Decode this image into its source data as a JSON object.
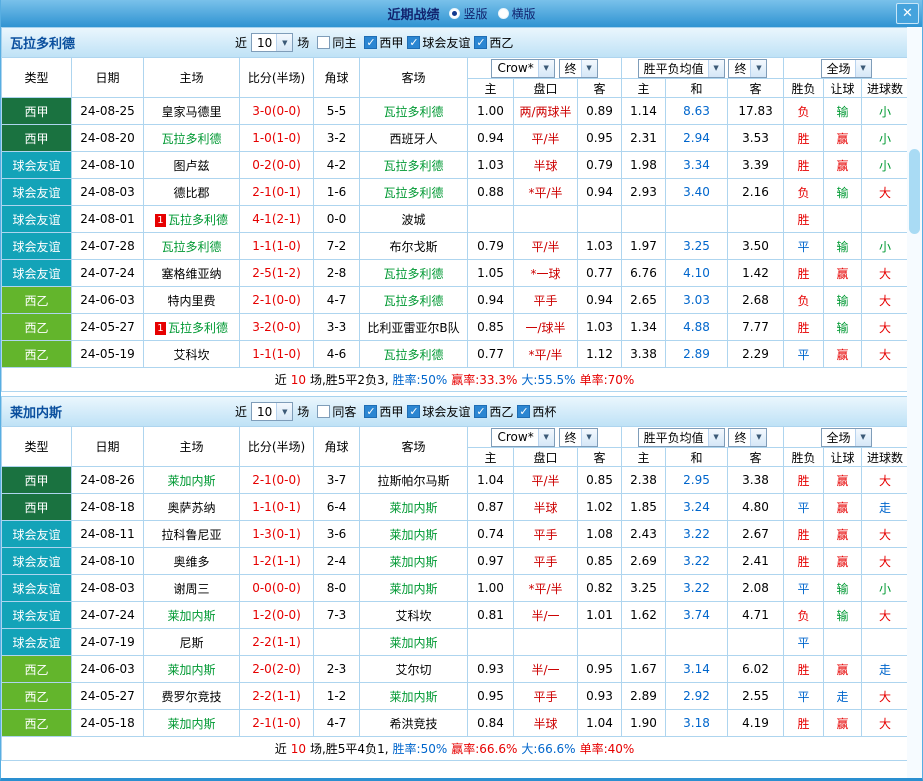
{
  "colors": {
    "titlebar_blue": "#2f93d2",
    "section_header_blue": "#bfe2f6",
    "table_border": "#aed5ef",
    "liga_badge_green": "#1a7240",
    "friendly_badge_teal": "#13a3b8",
    "segunda_badge_green": "#63b52c",
    "score_red": "#e60000",
    "self_team_green": "#009933",
    "draw_blue": "#0066cc"
  },
  "titlebar": {
    "title": "近期战绩",
    "radios": [
      {
        "label": "竖版",
        "selected": true
      },
      {
        "label": "横版",
        "selected": false
      }
    ],
    "close": "✕"
  },
  "sections": [
    {
      "team": "瓦拉多利德",
      "filters": {
        "near_label": "近",
        "count": "10",
        "games_label": "场",
        "same": {
          "label": "同主",
          "checked": false
        },
        "leagues": [
          {
            "label": "西甲",
            "checked": true
          },
          {
            "label": "球会友谊",
            "checked": true
          },
          {
            "label": "西乙",
            "checked": true
          }
        ]
      },
      "header": {
        "col_type": "类型",
        "col_date": "日期",
        "col_home": "主场",
        "col_score": "比分(半场)",
        "col_corner": "角球",
        "col_away": "客场",
        "odds_select": "Crow*",
        "odds_final": "终",
        "avg_select": "胜平负均值",
        "avg_final": "终",
        "scope_select": "全场",
        "sub": [
          "主",
          "盘口",
          "客",
          "主",
          "和",
          "客",
          "胜负",
          "让球",
          "进球数"
        ]
      },
      "rows": [
        {
          "type": "西甲",
          "tc": "lg1",
          "date": "24-08-25",
          "home": "皇家马德里",
          "hs": false,
          "hb": "",
          "score": "3-0(0-0)",
          "corner": "5-5",
          "away": "瓦拉多利德",
          "as": true,
          "o": [
            "1.00",
            "两/两球半",
            "0.89"
          ],
          "a": [
            "1.14",
            "8.63",
            "17.83"
          ],
          "r": [
            [
              "负",
              "red"
            ],
            [
              "输",
              "green"
            ],
            [
              "小",
              "green"
            ]
          ]
        },
        {
          "type": "西甲",
          "tc": "lg1",
          "date": "24-08-20",
          "home": "瓦拉多利德",
          "hs": true,
          "hb": "",
          "score": "1-0(1-0)",
          "corner": "3-2",
          "away": "西班牙人",
          "as": false,
          "o": [
            "0.94",
            "平/半",
            "0.95"
          ],
          "a": [
            "2.31",
            "2.94",
            "3.53"
          ],
          "r": [
            [
              "胜",
              "red"
            ],
            [
              "赢",
              "red"
            ],
            [
              "小",
              "green"
            ]
          ]
        },
        {
          "type": "球会友谊",
          "tc": "lg2",
          "date": "24-08-10",
          "home": "图卢兹",
          "hs": false,
          "hb": "",
          "score": "0-2(0-0)",
          "corner": "4-2",
          "away": "瓦拉多利德",
          "as": true,
          "o": [
            "1.03",
            "半球",
            "0.79"
          ],
          "a": [
            "1.98",
            "3.34",
            "3.39"
          ],
          "r": [
            [
              "胜",
              "red"
            ],
            [
              "赢",
              "red"
            ],
            [
              "小",
              "green"
            ]
          ]
        },
        {
          "type": "球会友谊",
          "tc": "lg2",
          "date": "24-08-03",
          "home": "德比郡",
          "hs": false,
          "hb": "",
          "score": "2-1(0-1)",
          "corner": "1-6",
          "away": "瓦拉多利德",
          "as": true,
          "o": [
            "0.88",
            "*平/半",
            "0.94"
          ],
          "a": [
            "2.93",
            "3.40",
            "2.16"
          ],
          "r": [
            [
              "负",
              "red"
            ],
            [
              "输",
              "green"
            ],
            [
              "大",
              "red"
            ]
          ]
        },
        {
          "type": "球会友谊",
          "tc": "lg2",
          "date": "24-08-01",
          "home": "瓦拉多利德",
          "hs": true,
          "hb": "1",
          "score": "4-1(2-1)",
          "corner": "0-0",
          "away": "波城",
          "as": false,
          "o": [
            "",
            "",
            ""
          ],
          "a": [
            "",
            "",
            ""
          ],
          "r": [
            [
              "胜",
              "red"
            ],
            [
              "",
              ""
            ],
            [
              "",
              ""
            ]
          ]
        },
        {
          "type": "球会友谊",
          "tc": "lg2",
          "date": "24-07-28",
          "home": "瓦拉多利德",
          "hs": true,
          "hb": "",
          "score": "1-1(1-0)",
          "corner": "7-2",
          "away": "布尔戈斯",
          "as": false,
          "o": [
            "0.79",
            "平/半",
            "1.03"
          ],
          "a": [
            "1.97",
            "3.25",
            "3.50"
          ],
          "r": [
            [
              "平",
              "blue"
            ],
            [
              "输",
              "green"
            ],
            [
              "小",
              "green"
            ]
          ]
        },
        {
          "type": "球会友谊",
          "tc": "lg2",
          "date": "24-07-24",
          "home": "塞格维亚纳",
          "hs": false,
          "hb": "",
          "score": "2-5(1-2)",
          "corner": "2-8",
          "away": "瓦拉多利德",
          "as": true,
          "o": [
            "1.05",
            "*一球",
            "0.77"
          ],
          "a": [
            "6.76",
            "4.10",
            "1.42"
          ],
          "r": [
            [
              "胜",
              "red"
            ],
            [
              "赢",
              "red"
            ],
            [
              "大",
              "red"
            ]
          ]
        },
        {
          "type": "西乙",
          "tc": "lg3",
          "date": "24-06-03",
          "home": "特内里费",
          "hs": false,
          "hb": "",
          "score": "2-1(0-0)",
          "corner": "4-7",
          "away": "瓦拉多利德",
          "as": true,
          "o": [
            "0.94",
            "平手",
            "0.94"
          ],
          "a": [
            "2.65",
            "3.03",
            "2.68"
          ],
          "r": [
            [
              "负",
              "red"
            ],
            [
              "输",
              "green"
            ],
            [
              "大",
              "red"
            ]
          ]
        },
        {
          "type": "西乙",
          "tc": "lg3",
          "date": "24-05-27",
          "home": "瓦拉多利德",
          "hs": true,
          "hb": "1",
          "score": "3-2(0-0)",
          "corner": "3-3",
          "away": "比利亚雷亚尔B队",
          "as": false,
          "o": [
            "0.85",
            "一/球半",
            "1.03"
          ],
          "a": [
            "1.34",
            "4.88",
            "7.77"
          ],
          "r": [
            [
              "胜",
              "red"
            ],
            [
              "输",
              "green"
            ],
            [
              "大",
              "red"
            ]
          ]
        },
        {
          "type": "西乙",
          "tc": "lg3",
          "date": "24-05-19",
          "home": "艾科坎",
          "hs": false,
          "hb": "",
          "score": "1-1(1-0)",
          "corner": "4-6",
          "away": "瓦拉多利德",
          "as": true,
          "o": [
            "0.77",
            "*平/半",
            "1.12"
          ],
          "a": [
            "3.38",
            "2.89",
            "2.29"
          ],
          "r": [
            [
              "平",
              "blue"
            ],
            [
              "赢",
              "red"
            ],
            [
              "大",
              "red"
            ]
          ]
        }
      ],
      "summary": [
        {
          "t": "近",
          "c": "dark"
        },
        {
          "t": "10",
          "c": "red"
        },
        {
          "t": "场,胜5平2负3,",
          "c": "dark"
        },
        {
          "t": "胜率:50%",
          "c": "blue"
        },
        {
          "t": "赢率:33.3%",
          "c": "red"
        },
        {
          "t": "大:55.5%",
          "c": "blue"
        },
        {
          "t": "单率:70%",
          "c": "red"
        }
      ]
    },
    {
      "team": "莱加内斯",
      "filters": {
        "near_label": "近",
        "count": "10",
        "games_label": "场",
        "same": {
          "label": "同客",
          "checked": false
        },
        "leagues": [
          {
            "label": "西甲",
            "checked": true
          },
          {
            "label": "球会友谊",
            "checked": true
          },
          {
            "label": "西乙",
            "checked": true
          },
          {
            "label": "西杯",
            "checked": true
          }
        ]
      },
      "header": {
        "col_type": "类型",
        "col_date": "日期",
        "col_home": "主场",
        "col_score": "比分(半场)",
        "col_corner": "角球",
        "col_away": "客场",
        "odds_select": "Crow*",
        "odds_final": "终",
        "avg_select": "胜平负均值",
        "avg_final": "终",
        "scope_select": "全场",
        "sub": [
          "主",
          "盘口",
          "客",
          "主",
          "和",
          "客",
          "胜负",
          "让球",
          "进球数"
        ]
      },
      "rows": [
        {
          "type": "西甲",
          "tc": "lg1",
          "date": "24-08-26",
          "home": "莱加内斯",
          "hs": true,
          "hb": "",
          "score": "2-1(0-0)",
          "corner": "3-7",
          "away": "拉斯帕尔马斯",
          "as": false,
          "o": [
            "1.04",
            "平/半",
            "0.85"
          ],
          "a": [
            "2.38",
            "2.95",
            "3.38"
          ],
          "r": [
            [
              "胜",
              "red"
            ],
            [
              "赢",
              "red"
            ],
            [
              "大",
              "red"
            ]
          ]
        },
        {
          "type": "西甲",
          "tc": "lg1",
          "date": "24-08-18",
          "home": "奥萨苏纳",
          "hs": false,
          "hb": "",
          "score": "1-1(0-1)",
          "corner": "6-4",
          "away": "莱加内斯",
          "as": true,
          "o": [
            "0.87",
            "半球",
            "1.02"
          ],
          "a": [
            "1.85",
            "3.24",
            "4.80"
          ],
          "r": [
            [
              "平",
              "blue"
            ],
            [
              "赢",
              "red"
            ],
            [
              "走",
              "blue"
            ]
          ]
        },
        {
          "type": "球会友谊",
          "tc": "lg2",
          "date": "24-08-11",
          "home": "拉科鲁尼亚",
          "hs": false,
          "hb": "",
          "score": "1-3(0-1)",
          "corner": "3-6",
          "away": "莱加内斯",
          "as": true,
          "o": [
            "0.74",
            "平手",
            "1.08"
          ],
          "a": [
            "2.43",
            "3.22",
            "2.67"
          ],
          "r": [
            [
              "胜",
              "red"
            ],
            [
              "赢",
              "red"
            ],
            [
              "大",
              "red"
            ]
          ]
        },
        {
          "type": "球会友谊",
          "tc": "lg2",
          "date": "24-08-10",
          "home": "奥维多",
          "hs": false,
          "hb": "",
          "score": "1-2(1-1)",
          "corner": "2-4",
          "away": "莱加内斯",
          "as": true,
          "o": [
            "0.97",
            "平手",
            "0.85"
          ],
          "a": [
            "2.69",
            "3.22",
            "2.41"
          ],
          "r": [
            [
              "胜",
              "red"
            ],
            [
              "赢",
              "red"
            ],
            [
              "大",
              "red"
            ]
          ]
        },
        {
          "type": "球会友谊",
          "tc": "lg2",
          "date": "24-08-03",
          "home": "谢周三",
          "hs": false,
          "hb": "",
          "score": "0-0(0-0)",
          "corner": "8-0",
          "away": "莱加内斯",
          "as": true,
          "o": [
            "1.00",
            "*平/半",
            "0.82"
          ],
          "a": [
            "3.25",
            "3.22",
            "2.08"
          ],
          "r": [
            [
              "平",
              "blue"
            ],
            [
              "输",
              "green"
            ],
            [
              "小",
              "green"
            ]
          ]
        },
        {
          "type": "球会友谊",
          "tc": "lg2",
          "date": "24-07-24",
          "home": "莱加内斯",
          "hs": true,
          "hb": "",
          "score": "1-2(0-0)",
          "corner": "7-3",
          "away": "艾科坎",
          "as": false,
          "o": [
            "0.81",
            "半/一",
            "1.01"
          ],
          "a": [
            "1.62",
            "3.74",
            "4.71"
          ],
          "r": [
            [
              "负",
              "red"
            ],
            [
              "输",
              "green"
            ],
            [
              "大",
              "red"
            ]
          ]
        },
        {
          "type": "球会友谊",
          "tc": "lg2",
          "date": "24-07-19",
          "home": "尼斯",
          "hs": false,
          "hb": "",
          "score": "2-2(1-1)",
          "corner": "",
          "away": "莱加内斯",
          "as": true,
          "o": [
            "",
            "",
            ""
          ],
          "a": [
            "",
            "",
            ""
          ],
          "r": [
            [
              "平",
              "blue"
            ],
            [
              "",
              ""
            ],
            [
              "",
              ""
            ]
          ]
        },
        {
          "type": "西乙",
          "tc": "lg3",
          "date": "24-06-03",
          "home": "莱加内斯",
          "hs": true,
          "hb": "",
          "score": "2-0(2-0)",
          "corner": "2-3",
          "away": "艾尔切",
          "as": false,
          "o": [
            "0.93",
            "半/一",
            "0.95"
          ],
          "a": [
            "1.67",
            "3.14",
            "6.02"
          ],
          "r": [
            [
              "胜",
              "red"
            ],
            [
              "赢",
              "red"
            ],
            [
              "走",
              "blue"
            ]
          ]
        },
        {
          "type": "西乙",
          "tc": "lg3",
          "date": "24-05-27",
          "home": "费罗尔竞技",
          "hs": false,
          "hb": "",
          "score": "2-2(1-1)",
          "corner": "1-2",
          "away": "莱加内斯",
          "as": true,
          "o": [
            "0.95",
            "平手",
            "0.93"
          ],
          "a": [
            "2.89",
            "2.92",
            "2.55"
          ],
          "r": [
            [
              "平",
              "blue"
            ],
            [
              "走",
              "blue"
            ],
            [
              "大",
              "red"
            ]
          ]
        },
        {
          "type": "西乙",
          "tc": "lg3",
          "date": "24-05-18",
          "home": "莱加内斯",
          "hs": true,
          "hb": "",
          "score": "2-1(1-0)",
          "corner": "4-7",
          "away": "希洪竞技",
          "as": false,
          "o": [
            "0.84",
            "半球",
            "1.04"
          ],
          "a": [
            "1.90",
            "3.18",
            "4.19"
          ],
          "r": [
            [
              "胜",
              "red"
            ],
            [
              "赢",
              "red"
            ],
            [
              "大",
              "red"
            ]
          ]
        }
      ],
      "summary": [
        {
          "t": "近",
          "c": "dark"
        },
        {
          "t": "10",
          "c": "red"
        },
        {
          "t": "场,胜5平4负1,",
          "c": "dark"
        },
        {
          "t": "胜率:50%",
          "c": "blue"
        },
        {
          "t": "赢率:66.6%",
          "c": "red"
        },
        {
          "t": "大:66.6%",
          "c": "blue"
        },
        {
          "t": "单率:40%",
          "c": "red"
        }
      ]
    }
  ]
}
